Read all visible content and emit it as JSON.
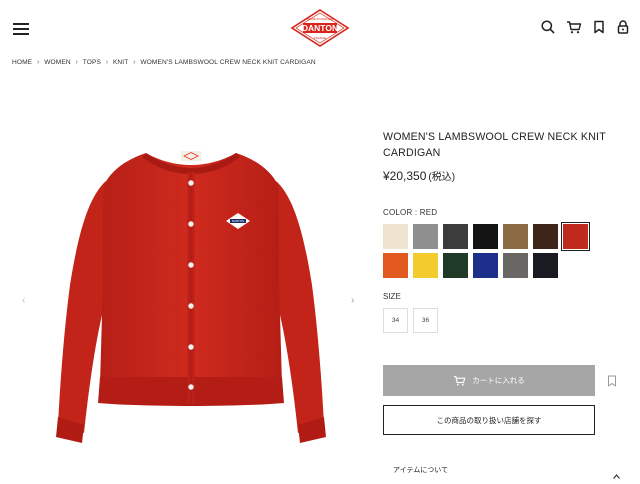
{
  "header": {
    "menu_icon": "hamburger-icon",
    "logo_text": "DANTON",
    "logo_ring_top": "MADE IN FRANCE",
    "logo_ring_bottom": "FRANCE",
    "icons": [
      "search-icon",
      "cart-icon",
      "bookmark-icon",
      "lock-icon"
    ]
  },
  "breadcrumb": [
    "HOME",
    "WOMEN",
    "TOPS",
    "KNIT",
    "WOMEN'S LAMBSWOOL CREW NECK KNIT CARDIGAN"
  ],
  "gallery": {
    "prev_arrow": "‹",
    "next_arrow": "›",
    "logo_badge_text": "DANTON"
  },
  "product": {
    "title": "WOMEN'S LAMBSWOOL CREW NECK KNIT CARDIGAN",
    "price": "¥20,350",
    "tax": "(税込)",
    "color_label": "COLOR : RED",
    "colors": [
      {
        "name": "ecru",
        "hex": "#efe4d0"
      },
      {
        "name": "light-grey",
        "hex": "#8f8f8f"
      },
      {
        "name": "charcoal",
        "hex": "#3c3c3c"
      },
      {
        "name": "black",
        "hex": "#141414"
      },
      {
        "name": "camel",
        "hex": "#8b6b43"
      },
      {
        "name": "brown",
        "hex": "#3e2519"
      },
      {
        "name": "red",
        "hex": "#c02a1c",
        "selected": true
      },
      {
        "name": "orange",
        "hex": "#e35a1f"
      },
      {
        "name": "yellow",
        "hex": "#f3cb2d"
      },
      {
        "name": "dark-green",
        "hex": "#1f3a27"
      },
      {
        "name": "royal-blue",
        "hex": "#1c2f8a"
      },
      {
        "name": "heather-grey",
        "hex": "#6a6664"
      },
      {
        "name": "navy-black",
        "hex": "#1a1b22"
      }
    ],
    "size_label": "SIZE",
    "sizes": [
      "34",
      "36"
    ],
    "add_to_cart": "カートに入れる",
    "find_store": "この商品の取り扱い店舗を探す",
    "about_item": "アイテムについて"
  },
  "colors": {
    "garment_red": "#c8241a",
    "logo_red": "#d8261c",
    "cart_button_bg": "#a6a6a6"
  }
}
